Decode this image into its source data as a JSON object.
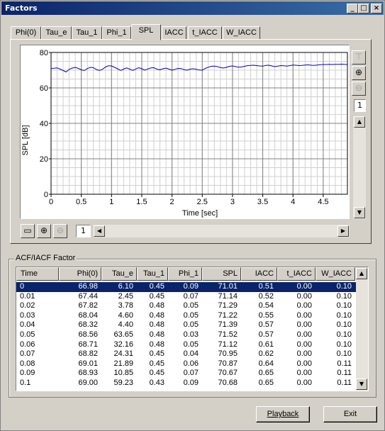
{
  "window": {
    "title": "Factors"
  },
  "tabs": [
    "Phi(0)",
    "Tau_e",
    "Tau_1",
    "Phi_1",
    "SPL",
    "IACC",
    "t_IACC",
    "W_IACC"
  ],
  "active_tab": "SPL",
  "toolbar_right": {
    "page": "1"
  },
  "toolbar_bottom": {
    "page": "1"
  },
  "chart_data": {
    "type": "line",
    "xlabel": "Time [sec]",
    "ylabel": "SPL [dB]",
    "xlim": [
      0,
      4.9
    ],
    "ylim": [
      0,
      80
    ],
    "xticks": [
      "0",
      "0.5",
      "1",
      "1.5",
      "2",
      "2.5",
      "3",
      "3.5",
      "4",
      "4.5"
    ],
    "yticks": [
      "0",
      "20",
      "40",
      "60",
      "80"
    ],
    "grid": true,
    "series": [
      {
        "color": "#0000c0",
        "x": [
          0,
          0.05,
          0.1,
          0.15,
          0.2,
          0.25,
          0.3,
          0.35,
          0.4,
          0.45,
          0.5,
          0.55,
          0.6,
          0.65,
          0.7,
          0.75,
          0.8,
          0.85,
          0.9,
          0.95,
          1.0,
          1.05,
          1.1,
          1.15,
          1.2,
          1.25,
          1.3,
          1.35,
          1.4,
          1.45,
          1.5,
          1.55,
          1.6,
          1.65,
          1.7,
          1.75,
          1.8,
          1.85,
          1.9,
          1.95,
          2.0,
          2.05,
          2.1,
          2.15,
          2.2,
          2.25,
          2.3,
          2.35,
          2.4,
          2.45,
          2.5,
          2.55,
          2.6,
          2.65,
          2.7,
          2.75,
          2.8,
          2.85,
          2.9,
          2.95,
          3.0,
          3.05,
          3.1,
          3.15,
          3.2,
          3.25,
          3.3,
          3.35,
          3.4,
          3.45,
          3.5,
          3.55,
          3.6,
          3.65,
          3.7,
          3.75,
          3.8,
          3.85,
          3.9,
          3.95,
          4.0,
          4.05,
          4.1,
          4.15,
          4.2,
          4.25,
          4.3,
          4.35,
          4.4,
          4.45,
          4.5,
          4.55,
          4.6,
          4.65,
          4.7,
          4.75,
          4.8,
          4.85,
          4.9
        ],
        "y": [
          71.0,
          71.1,
          71.3,
          70.6,
          69.8,
          69.0,
          70.5,
          71.2,
          71.6,
          71.0,
          70.2,
          69.8,
          70.9,
          71.6,
          71.4,
          70.4,
          69.9,
          70.5,
          71.8,
          72.5,
          72.4,
          71.6,
          70.8,
          69.9,
          70.6,
          71.3,
          70.6,
          69.9,
          70.7,
          71.4,
          70.8,
          70.0,
          70.7,
          71.3,
          71.4,
          70.6,
          70.2,
          70.8,
          71.2,
          70.6,
          70.0,
          70.5,
          71.0,
          70.9,
          70.3,
          70.0,
          70.6,
          70.8,
          70.5,
          70.1,
          70.0,
          71.0,
          71.7,
          72.2,
          72.3,
          72.0,
          71.5,
          71.2,
          71.6,
          72.2,
          72.4,
          72.0,
          71.7,
          71.8,
          72.2,
          72.6,
          72.7,
          72.8,
          72.6,
          72.4,
          72.3,
          72.7,
          72.8,
          72.4,
          72.0,
          72.3,
          72.6,
          72.5,
          72.3,
          72.6,
          72.9,
          72.8,
          72.6,
          72.7,
          72.9,
          73.0,
          72.8,
          72.7,
          72.9,
          73.1,
          73.2,
          73.2,
          73.3,
          73.2,
          73.3,
          73.3,
          73.4,
          73.3,
          73.2
        ]
      }
    ]
  },
  "factor_group": {
    "label": "ACF/IACF Factor"
  },
  "table": {
    "columns": [
      "Time",
      "Phi(0)",
      "Tau_e",
      "Tau_1",
      "Phi_1",
      "SPL",
      "IACC",
      "t_IACC",
      "W_IACC"
    ],
    "rows": [
      [
        "0",
        "66.98",
        "6.10",
        "0.45",
        "0.09",
        "71.01",
        "0.51",
        "0.00",
        "0.10"
      ],
      [
        "0.01",
        "67.44",
        "2.45",
        "0.45",
        "0.07",
        "71.14",
        "0.52",
        "0.00",
        "0.10"
      ],
      [
        "0.02",
        "67.82",
        "3.78",
        "0.48",
        "0.05",
        "71.29",
        "0.54",
        "0.00",
        "0.10"
      ],
      [
        "0.03",
        "68.04",
        "4.60",
        "0.48",
        "0.05",
        "71.22",
        "0.55",
        "0.00",
        "0.10"
      ],
      [
        "0.04",
        "68.32",
        "4.40",
        "0.48",
        "0.05",
        "71.39",
        "0.57",
        "0.00",
        "0.10"
      ],
      [
        "0.05",
        "68.56",
        "63.65",
        "0.48",
        "0.03",
        "71.52",
        "0.57",
        "0.00",
        "0.10"
      ],
      [
        "0.06",
        "68.71",
        "32.16",
        "0.48",
        "0.05",
        "71.12",
        "0.61",
        "0.00",
        "0.10"
      ],
      [
        "0.07",
        "68.82",
        "24.31",
        "0.45",
        "0.04",
        "70.95",
        "0.62",
        "0.00",
        "0.10"
      ],
      [
        "0.08",
        "69.01",
        "21.89",
        "0.45",
        "0.06",
        "70.87",
        "0.64",
        "0.00",
        "0.11"
      ],
      [
        "0.09",
        "68.93",
        "10.85",
        "0.45",
        "0.07",
        "70.67",
        "0.65",
        "0.00",
        "0.11"
      ],
      [
        "0.1",
        "69.00",
        "59.23",
        "0.43",
        "0.09",
        "70.68",
        "0.65",
        "0.00",
        "0.11"
      ]
    ],
    "selected_row": 0
  },
  "buttons": {
    "playback": "Playback",
    "exit": "Exit"
  }
}
